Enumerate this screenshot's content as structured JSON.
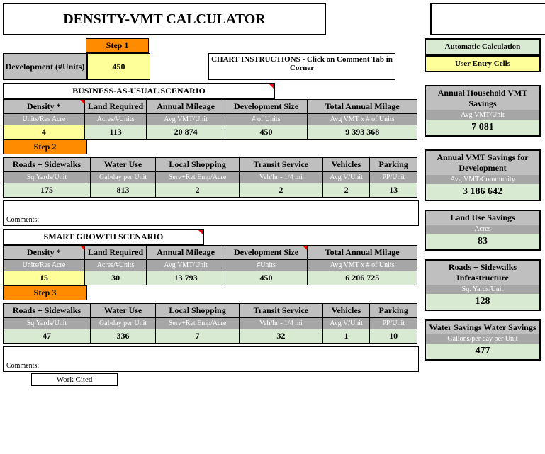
{
  "title": "DENSITY-VMT CALCULATOR",
  "legend": {
    "auto": "Automatic Calculation",
    "user": "User Entry Cells"
  },
  "steps": {
    "s1": "Step 1",
    "s2": "Step 2",
    "s3": "Step 3"
  },
  "development": {
    "label": "Development (#Units)",
    "value": "450"
  },
  "chart_instructions": "CHART INSTRUCTIONS - Click on Comment Tab in Corner",
  "bau": {
    "title": "BUSINESS-AS-USUAL SCENARIO",
    "h": [
      "Density *",
      "Land Required",
      "Annual Mileage",
      "Development Size",
      "Total Annual Milage"
    ],
    "u": [
      "Units/Res Acre",
      "Acres/#Units",
      "Avg VMT/Unit",
      "# of Units",
      "Avg VMT x # of Units"
    ],
    "v": [
      "4",
      "113",
      "20 874",
      "450",
      "9 393 368"
    ],
    "h2": [
      "Roads + Sidewalks",
      "Water Use",
      "Local Shopping",
      "Transit Service",
      "Vehicles",
      "Parking"
    ],
    "u2": [
      "Sq.Yards/Unit",
      "Gal/day per Unit",
      "Serv+Ret Emp/Acre",
      "Veh/hr - 1/4 mi",
      "Avg V/Unit",
      "PP/Unit"
    ],
    "v2": [
      "175",
      "813",
      "2",
      "2",
      "2",
      "13"
    ]
  },
  "sg": {
    "title": "SMART GROWTH SCENARIO",
    "h": [
      "Density *",
      "Land Required",
      "Annual Mileage",
      "Development Size",
      "Total Annual Milage"
    ],
    "u": [
      "Units/Res Acre",
      "Acres/#Units",
      "Avg VMT/Unit",
      "#Units",
      "Avg VMT x # of Units"
    ],
    "v": [
      "15",
      "30",
      "13 793",
      "450",
      "6 206 725"
    ],
    "h2": [
      "Roads + Sidewalks",
      "Water Use",
      "Local Shopping",
      "Transit Service",
      "Vehicles",
      "Parking"
    ],
    "u2": [
      "Sq.Yards/Unit",
      "Gal/day per Unit",
      "Serv+Ret Emp/Acre",
      "Veh/hr - 1/4 mi",
      "Avg V/Unit",
      "PP/Unit"
    ],
    "v2": [
      "47",
      "336",
      "7",
      "32",
      "1",
      "10"
    ]
  },
  "comments": "Comments:",
  "work_cited": "Work Cited",
  "side": {
    "s1": {
      "h": "Annual Household VMT Savings",
      "u": "Avg VMT/Unit",
      "v": "7 081"
    },
    "s2": {
      "h": "Annual VMT Savings for Development",
      "u": "Avg VMT/Community",
      "v": "3 186 642"
    },
    "s3": {
      "h": "Land Use Savings",
      "u": "Acres",
      "v": "83"
    },
    "s4": {
      "h": "Roads + Sidewalks Infrastructure",
      "u": "Sq. Yards/Unit",
      "v": "128"
    },
    "s5": {
      "h": "Water Savings Water Savings",
      "u": "Gallons/per day per Unit",
      "v": "477"
    }
  }
}
